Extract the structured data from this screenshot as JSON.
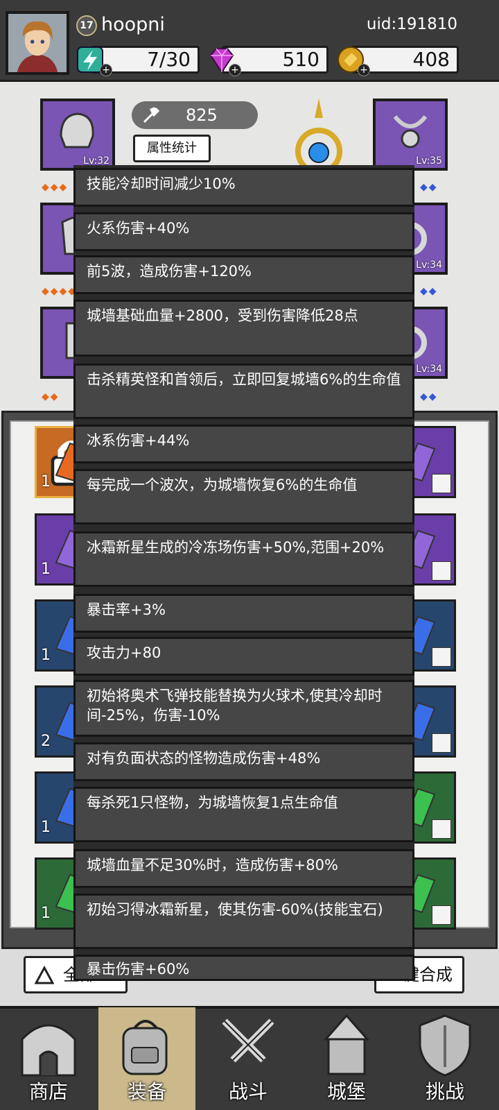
{
  "header": {
    "level": "17",
    "username": "hoopni",
    "uid": "uid:191810",
    "energy": "7/30",
    "gems": "510",
    "coins": "408"
  },
  "equipment": {
    "power": "825",
    "stats_button": "属性统计",
    "slots": [
      {
        "name": "helmet",
        "level": "Lv:32"
      },
      {
        "name": "amulet",
        "level": "Lv:35"
      },
      {
        "name": "armor",
        "level": ""
      },
      {
        "name": "ring",
        "level": "Lv:34"
      },
      {
        "name": "boots",
        "level": ""
      },
      {
        "name": "ring-2",
        "level": "Lv:34"
      }
    ]
  },
  "inventory": {
    "counts": [
      "1",
      "1",
      "1",
      "2",
      "1",
      "1"
    ]
  },
  "bottom_buttons": {
    "filter": "全部",
    "merge": "一键合成"
  },
  "tooltips": [
    "技能冷却时间减少10%",
    "火系伤害+40%",
    "前5波，造成伤害+120%",
    "城墙基础血量+2800，受到伤害降低28点",
    "击杀精英怪和首领后，立即回复城墙6%的生命值",
    "冰系伤害+44%",
    "每完成一个波次，为城墙恢复6%的生命值",
    "冰霜新星生成的冷冻场伤害+50%,范围+20%",
    "暴击率+3%",
    "攻击力+80",
    "初始将奥术飞弹技能替换为火球术,使其冷却时间-25%，伤害-10%",
    "对有负面状态的怪物造成伤害+48%",
    "每杀死1只怪物，为城墙恢复1点生命值",
    "城墙血量不足30%时，造成伤害+80%",
    "初始习得冰霜新星，使其伤害-60%(技能宝石)",
    "暴击伤害+60%"
  ],
  "nav": {
    "shop": "商店",
    "equip": "装备",
    "battle": "战斗",
    "castle": "城堡",
    "challenge": "挑战"
  }
}
